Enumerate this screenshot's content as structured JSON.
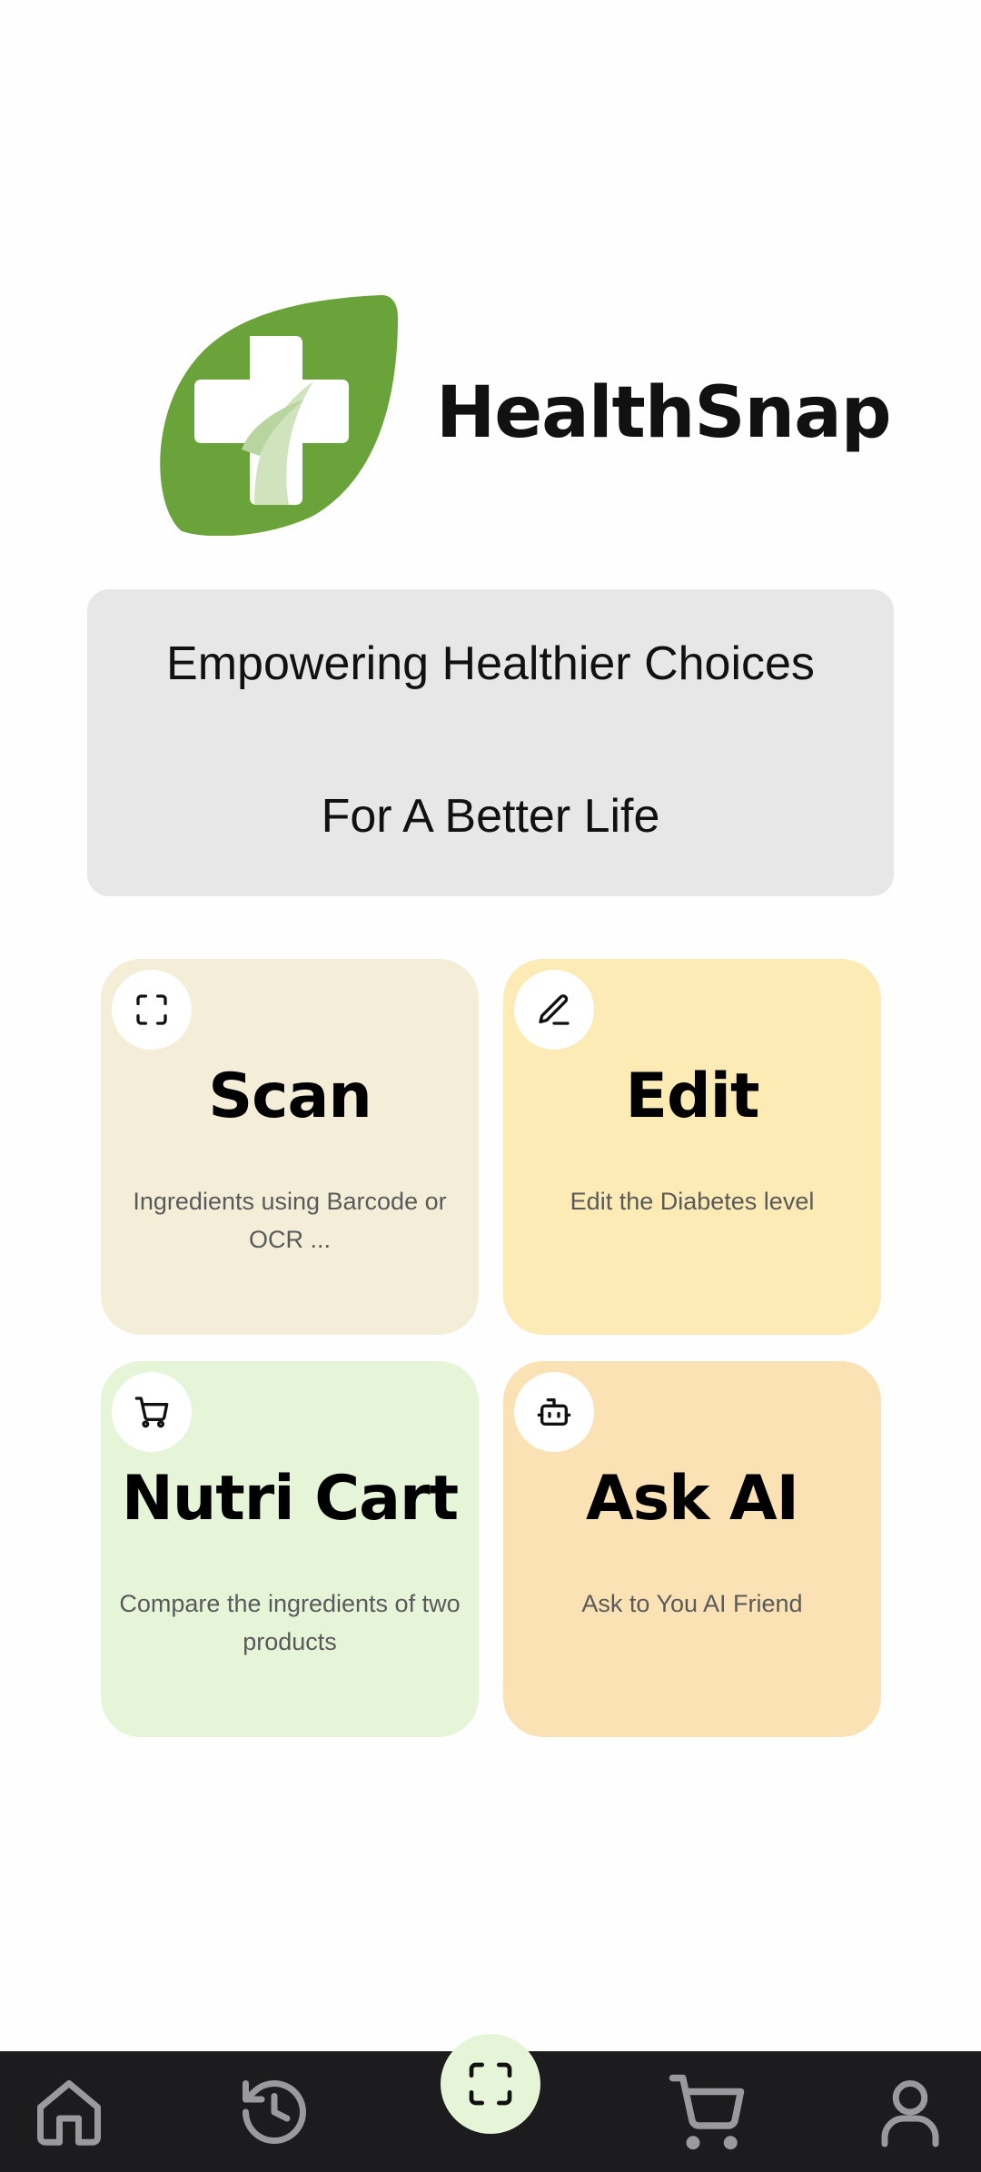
{
  "brand": {
    "name": "HealthSnap",
    "logo_icon": "health-leaf-cross-logo",
    "leaf_color": "#6aa33a"
  },
  "tagline": {
    "line1": "Empowering Healthier Choices",
    "line2": "For A Better Life"
  },
  "cards": [
    {
      "title": "Scan",
      "description": "Ingredients using Barcode or OCR ...",
      "icon": "scan-icon",
      "color": "#f4eed8"
    },
    {
      "title": "Edit",
      "description": "Edit the Diabetes level",
      "icon": "pencil-icon",
      "color": "#fcebb5"
    },
    {
      "title": "Nutri Cart",
      "description": "Compare the ingredients of two products",
      "icon": "cart-icon",
      "color": "#e6f4d8"
    },
    {
      "title": "Ask AI",
      "description": "Ask to You AI Friend",
      "icon": "robot-icon",
      "color": "#fbe2b4"
    }
  ],
  "bottom_nav": {
    "items": [
      "home-icon",
      "history-icon",
      "scan-icon",
      "cart-icon",
      "profile-icon"
    ],
    "background": "#1c1c1e",
    "icon_color": "#9a9a9e",
    "fab_color": "#e6f4d8"
  }
}
